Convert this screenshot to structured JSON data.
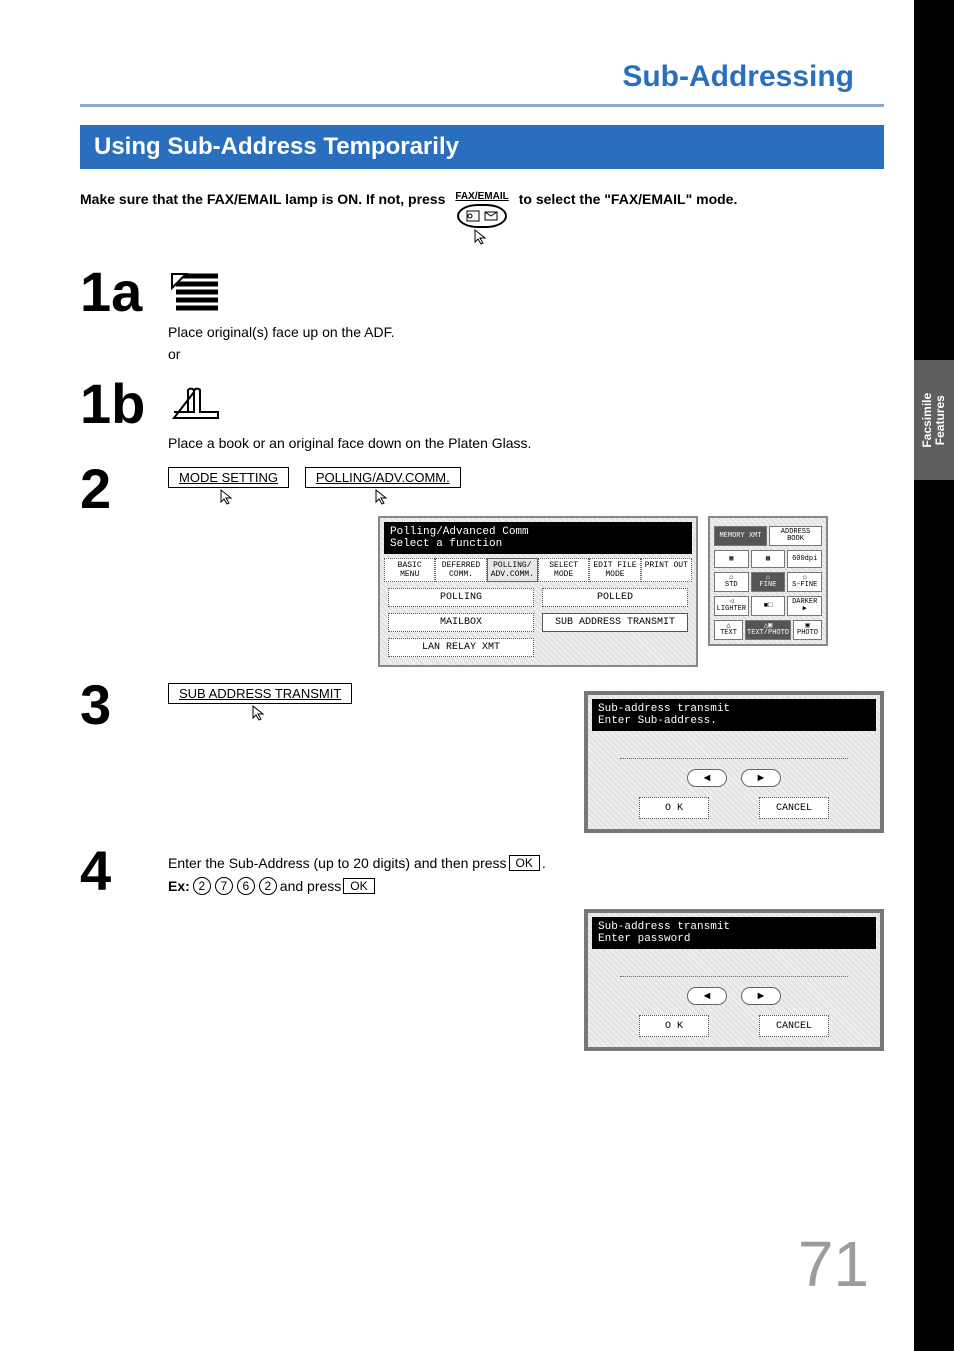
{
  "sideTab": "Facsimile\nFeatures",
  "title": "Sub-Addressing",
  "sectionBar": "Using Sub-Address Temporarily",
  "intro": {
    "part1": "Make sure that the FAX/EMAIL lamp is ON.  If not, press",
    "faxBtnLabel": "FAX/EMAIL",
    "part2": "to select the \"FAX/EMAIL\" mode."
  },
  "steps": {
    "s1a": {
      "num": "1a",
      "text": "Place original(s) face up on the ADF.",
      "or": "or"
    },
    "s1b": {
      "num": "1b",
      "text": "Place a book or an original face down on the Platen Glass."
    },
    "s2": {
      "num": "2",
      "btn1": "MODE SETTING",
      "btn2": "POLLING/ADV.COMM."
    },
    "s3": {
      "num": "3",
      "btn": "SUB ADDRESS TRANSMIT"
    },
    "s4": {
      "num": "4",
      "line1a": "Enter the Sub-Address (up to 20 digits) and then press ",
      "okKey": "OK",
      "line1b": ".",
      "exLabel": "Ex:",
      "digits": [
        "2",
        "7",
        "6",
        "2"
      ],
      "andPress": " and press "
    }
  },
  "panelMain": {
    "head1": "Polling/Advanced Comm",
    "head2": "Select a function",
    "tabs": [
      "BASIC MENU",
      "DEFERRED COMM.",
      "POLLING/ ADV.COMM.",
      "SELECT MODE",
      "EDIT FILE MODE",
      "PRINT OUT"
    ],
    "buttons": [
      "POLLING",
      "POLLED",
      "MAILBOX",
      "SUB ADDRESS TRANSMIT",
      "LAN RELAY XMT"
    ]
  },
  "panelSide": {
    "topRow": [
      "MEMORY XMT",
      "ADDRESS BOOK"
    ],
    "resRow": [
      "",
      "",
      "600dpi"
    ],
    "fineRow": [
      "STD",
      "FINE",
      "S-FINE"
    ],
    "contrastRow": [
      "LIGHTER",
      "",
      "DARKER"
    ],
    "modeRow": [
      "TEXT",
      "TEXT/PHOTO",
      "PHOTO"
    ]
  },
  "popup1": {
    "head1": "Sub-address transmit",
    "head2": "Enter Sub-address.",
    "ok": "O K",
    "cancel": "CANCEL"
  },
  "popup2": {
    "head1": "Sub-address transmit",
    "head2": "Enter password",
    "ok": "O K",
    "cancel": "CANCEL"
  },
  "pageNumber": "71"
}
